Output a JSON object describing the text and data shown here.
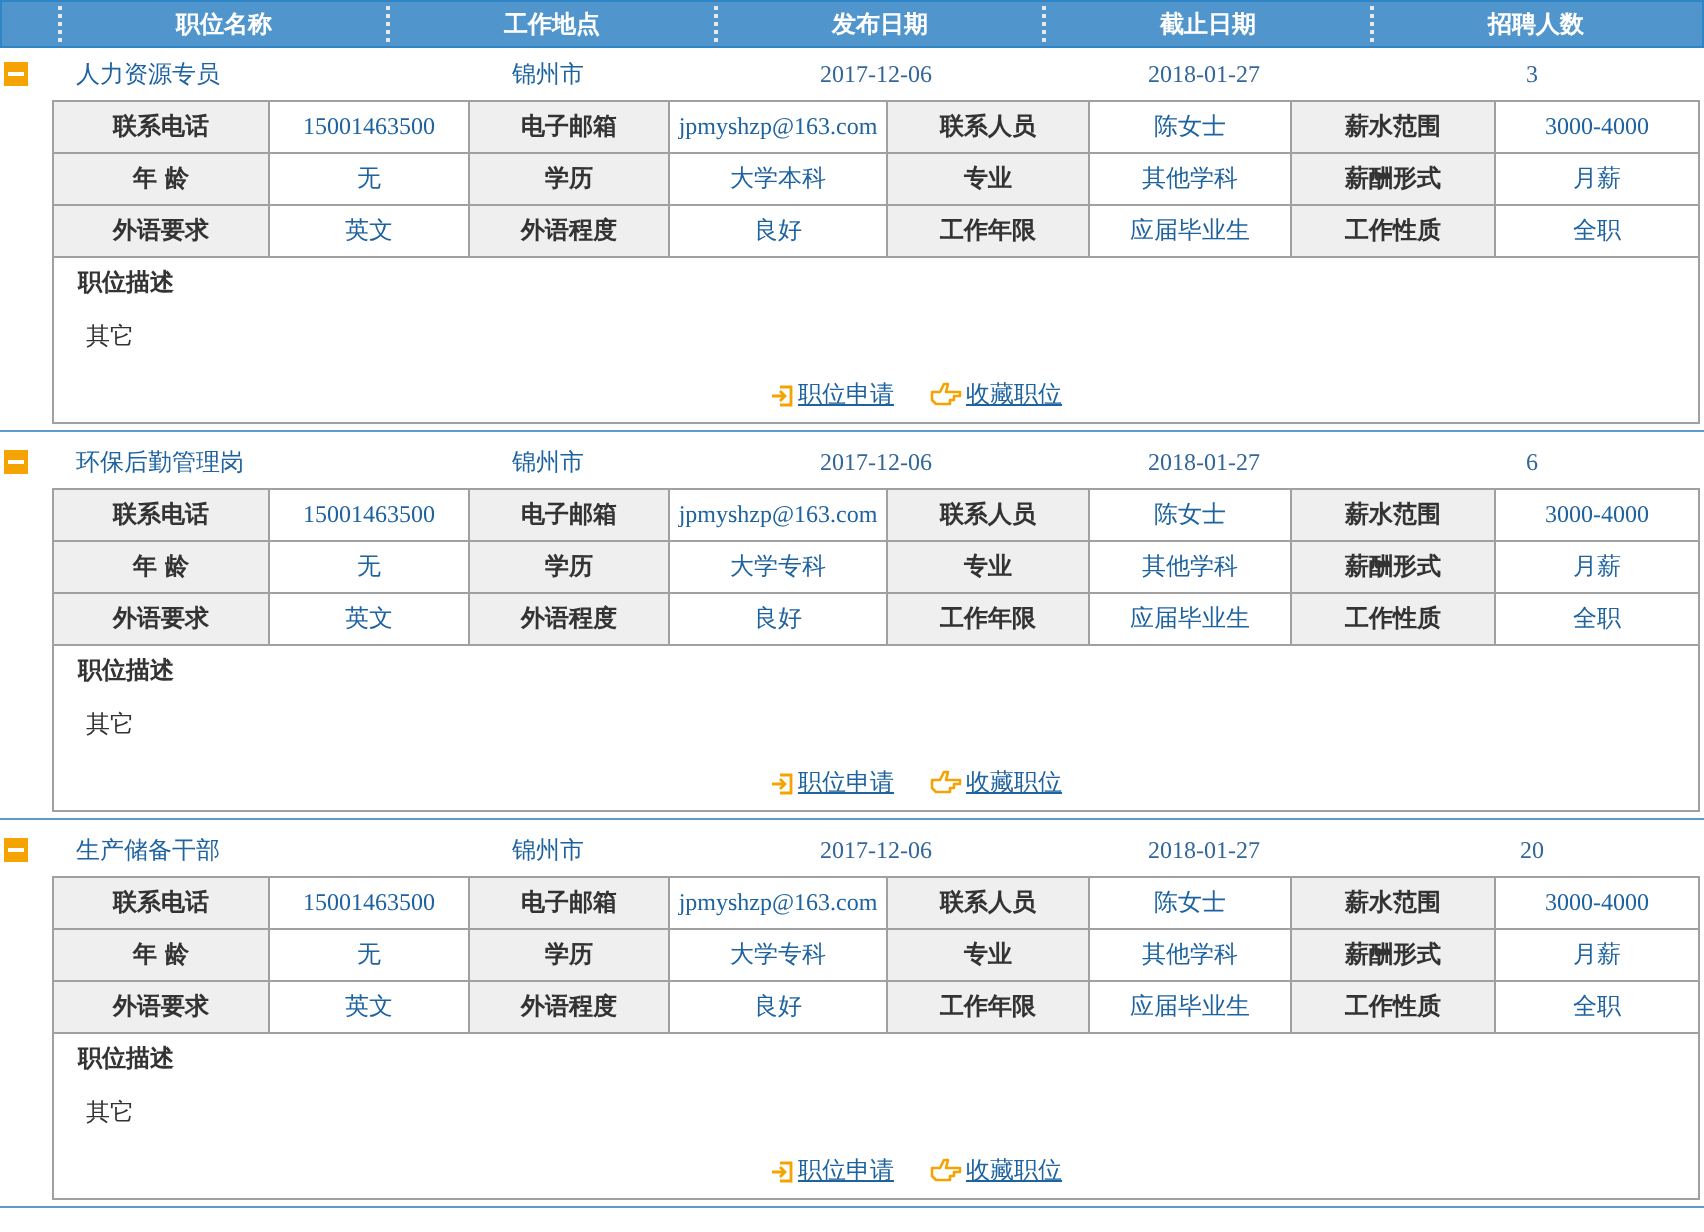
{
  "columns": [
    "职位名称",
    "工作地点",
    "发布日期",
    "截止日期",
    "招聘人数"
  ],
  "jobs": [
    {
      "expanded": true,
      "title": "人力资源专员",
      "location": "锦州市",
      "posted": "2017-12-06",
      "deadline": "2018-01-27",
      "openings": "3",
      "details": [
        [
          "联系电话",
          "15001463500",
          "电子邮箱",
          "jpmyshzp@163.com",
          "联系人员",
          "陈女士",
          "薪水范围",
          "3000-4000"
        ],
        [
          "年 龄",
          "无",
          "学历",
          "大学本科",
          "专业",
          "其他学科",
          "薪酬形式",
          "月薪"
        ],
        [
          "外语要求",
          "英文",
          "外语程度",
          "良好",
          "工作年限",
          "应届毕业生",
          "工作性质",
          "全职"
        ]
      ],
      "description_label": "职位描述",
      "description": "其它",
      "apply": "职位申请",
      "save": "收藏职位"
    },
    {
      "expanded": true,
      "title": "环保后勤管理岗",
      "location": "锦州市",
      "posted": "2017-12-06",
      "deadline": "2018-01-27",
      "openings": "6",
      "details": [
        [
          "联系电话",
          "15001463500",
          "电子邮箱",
          "jpmyshzp@163.com",
          "联系人员",
          "陈女士",
          "薪水范围",
          "3000-4000"
        ],
        [
          "年 龄",
          "无",
          "学历",
          "大学专科",
          "专业",
          "其他学科",
          "薪酬形式",
          "月薪"
        ],
        [
          "外语要求",
          "英文",
          "外语程度",
          "良好",
          "工作年限",
          "应届毕业生",
          "工作性质",
          "全职"
        ]
      ],
      "description_label": "职位描述",
      "description": "其它",
      "apply": "职位申请",
      "save": "收藏职位"
    },
    {
      "expanded": true,
      "title": "生产储备干部",
      "location": "锦州市",
      "posted": "2017-12-06",
      "deadline": "2018-01-27",
      "openings": "20",
      "details": [
        [
          "联系电话",
          "15001463500",
          "电子邮箱",
          "jpmyshzp@163.com",
          "联系人员",
          "陈女士",
          "薪水范围",
          "3000-4000"
        ],
        [
          "年 龄",
          "无",
          "学历",
          "大学专科",
          "专业",
          "其他学科",
          "薪酬形式",
          "月薪"
        ],
        [
          "外语要求",
          "英文",
          "外语程度",
          "良好",
          "工作年限",
          "应届毕业生",
          "工作性质",
          "全职"
        ]
      ],
      "description_label": "职位描述",
      "description": "其它",
      "apply": "职位申请",
      "save": "收藏职位"
    }
  ]
}
